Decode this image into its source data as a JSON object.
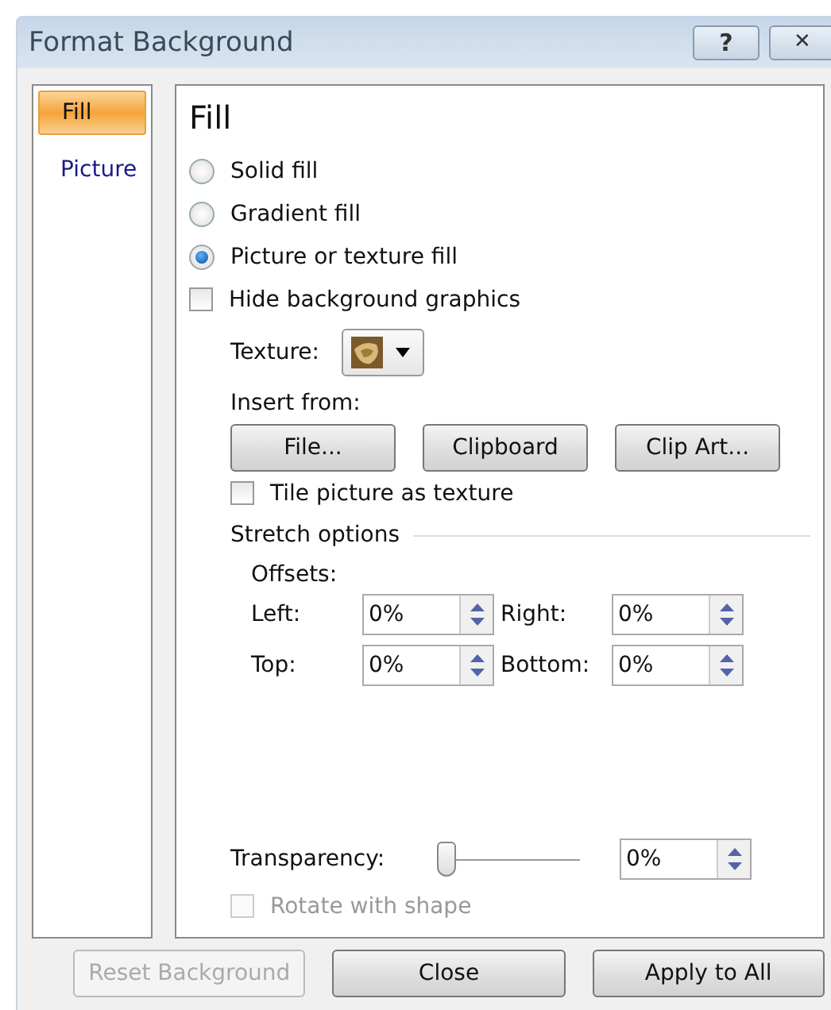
{
  "window": {
    "title": "Format Background",
    "buttons": [
      {
        "kind": "help",
        "label": "?"
      },
      {
        "kind": "close",
        "label": "✕"
      }
    ]
  },
  "sidebar": {
    "items": [
      {
        "label": "Fill",
        "selected": true
      },
      {
        "label": "Picture",
        "selected": false
      }
    ]
  },
  "panel": {
    "heading": "Fill",
    "fill_options": [
      {
        "label": "Solid fill",
        "selected": false
      },
      {
        "label": "Gradient fill",
        "selected": false
      },
      {
        "label": "Picture or texture fill",
        "selected": true
      }
    ],
    "hide_background": {
      "label": "Hide background graphics",
      "checked": false
    },
    "texture": {
      "label": "Texture:"
    },
    "insert_from": {
      "label": "Insert from:",
      "buttons": [
        "File...",
        "Clipboard",
        "Clip Art..."
      ]
    },
    "tile": {
      "label": "Tile picture as texture",
      "checked": false
    },
    "stretch": {
      "heading": "Stretch options",
      "offsets_label": "Offsets:",
      "offsets": [
        {
          "label": "Left:",
          "value": "0%"
        },
        {
          "label": "Right:",
          "value": "0%"
        },
        {
          "label": "Top:",
          "value": "0%"
        },
        {
          "label": "Bottom:",
          "value": "0%"
        }
      ]
    },
    "transparency": {
      "label": "Transparency:",
      "level": 0,
      "value": "0%"
    },
    "rotate": {
      "label": "Rotate with shape",
      "checked": false,
      "disabled": true
    }
  },
  "footer": {
    "buttons": [
      {
        "label": "Reset Background",
        "disabled": true
      },
      {
        "label": "Close",
        "disabled": false
      },
      {
        "label": "Apply to All",
        "disabled": false
      }
    ]
  }
}
